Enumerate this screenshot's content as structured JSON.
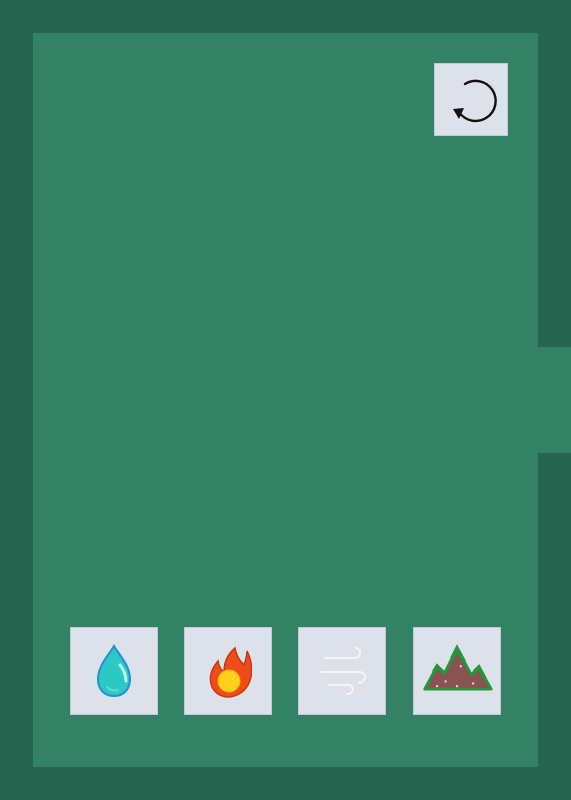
{
  "screen": {
    "domain": "Game"
  },
  "controls": {
    "reset_icon": "reset-icon"
  },
  "elements": [
    {
      "id": "water",
      "icon": "water-drop-icon"
    },
    {
      "id": "fire",
      "icon": "fire-icon"
    },
    {
      "id": "air",
      "icon": "wind-icon"
    },
    {
      "id": "earth",
      "icon": "mountain-icon"
    }
  ],
  "colors": {
    "outer_wall": "#25654f",
    "playfield": "#338266",
    "tile_background": "#dde1ea",
    "water": "#2bc9c3",
    "fire_outer": "#ef4b1d",
    "fire_inner": "#ffd11a",
    "earth": "#8a5253",
    "earth_outline": "#22983a"
  }
}
